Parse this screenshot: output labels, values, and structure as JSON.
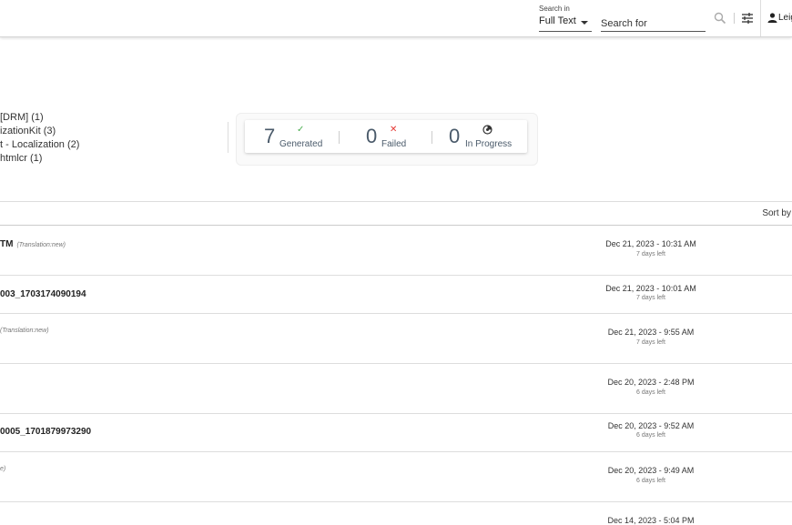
{
  "header": {
    "search_in_label": "Search in",
    "search_in_value": "Full Text",
    "search_placeholder": "Search for",
    "user_name": "Leig"
  },
  "facets": [
    "[DRM] (1)",
    "izationKit (3)",
    "t - Localization (2)",
    "htmlcr (1)"
  ],
  "summary": {
    "generated": {
      "count": "7",
      "label": "Generated",
      "icon": "check-icon",
      "color": "#4caf50"
    },
    "failed": {
      "count": "0",
      "label": "Failed",
      "icon": "x-icon",
      "color": "#e53935"
    },
    "in_progress": {
      "count": "0",
      "label": "In Progress",
      "icon": "spinner-icon",
      "color": "#333333"
    }
  },
  "list": {
    "sort_label": "Sort by"
  },
  "rows": [
    {
      "title": "TM",
      "tag": "(Translation:new)",
      "date": "Dec 21, 2023 - 10:31 AM",
      "left": "7 days left"
    },
    {
      "title": "003_1703174090194",
      "tag": "",
      "date": "Dec 21, 2023 - 10:01 AM",
      "left": "7 days left"
    },
    {
      "title": "",
      "tag": "(Translation:new)",
      "date": "Dec 21, 2023 - 9:55 AM",
      "left": "7 days left"
    },
    {
      "title": "",
      "tag": "",
      "date": "Dec 20, 2023 - 2:48 PM",
      "left": "6 days left"
    },
    {
      "title": "0005_1701879973290",
      "tag": "",
      "date": "Dec 20, 2023 - 9:52 AM",
      "left": "6 days left"
    },
    {
      "title": "",
      "tag": "e)",
      "date": "Dec 20, 2023 - 9:49 AM",
      "left": "6 days left"
    },
    {
      "title": "",
      "tag": "",
      "date": "Dec 14, 2023 - 5:04 PM",
      "left": ""
    }
  ]
}
